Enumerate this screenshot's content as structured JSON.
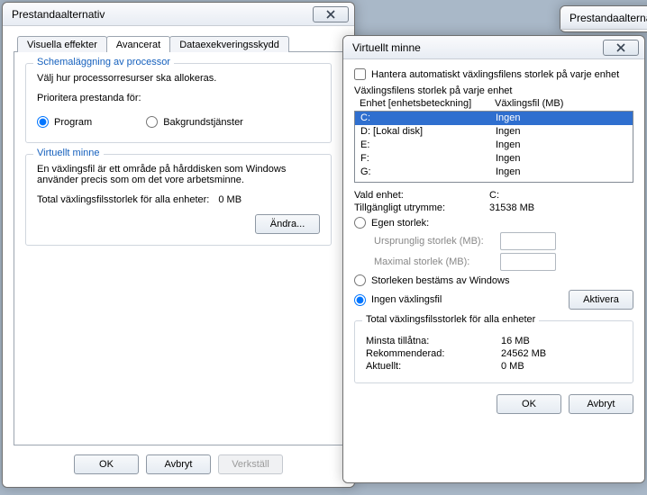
{
  "bgWindow": {
    "title": "Prestandaalternat"
  },
  "perf": {
    "title": "Prestandaalternativ",
    "tabs": {
      "visual": "Visuella effekter",
      "advanced": "Avancerat",
      "dep": "Dataexekveringsskydd"
    },
    "scheduling": {
      "legend": "Schemaläggning av processor",
      "desc": "Välj hur processorresurser ska allokeras.",
      "prioritize": "Prioritera prestanda för:",
      "programs": "Program",
      "background": "Bakgrundstjänster"
    },
    "virtualMemory": {
      "legend": "Virtuellt minne",
      "desc": "En växlingsfil är ett område på hårddisken som Windows använder precis som om det vore arbetsminne.",
      "totalLabel": "Total växlingsfilsstorlek för alla enheter:",
      "totalValue": "0 MB",
      "change": "Ändra..."
    },
    "buttons": {
      "ok": "OK",
      "cancel": "Avbryt",
      "apply": "Verkställ"
    }
  },
  "vm": {
    "title": "Virtuellt minne",
    "autoManage": "Hantera automatiskt växlingsfilens storlek på varje enhet",
    "pageFileSizeHeading": "Växlingsfilens storlek på varje enhet",
    "col1": "Enhet [enhetsbeteckning]",
    "col2": "Växlingsfil (MB)",
    "drives": [
      {
        "letter": "C:",
        "label": "",
        "page": "Ingen",
        "selected": true
      },
      {
        "letter": "D:",
        "label": "[Lokal disk]",
        "page": "Ingen",
        "selected": false
      },
      {
        "letter": "E:",
        "label": "",
        "page": "Ingen",
        "selected": false
      },
      {
        "letter": "F:",
        "label": "",
        "page": "Ingen",
        "selected": false
      },
      {
        "letter": "G:",
        "label": "",
        "page": "Ingen",
        "selected": false
      }
    ],
    "selectedDriveLabel": "Vald enhet:",
    "selectedDriveValue": "C:",
    "availLabel": "Tillgängligt utrymme:",
    "availValue": "31538 MB",
    "customSize": "Egen storlek:",
    "initialSize": "Ursprunglig storlek (MB):",
    "maxSize": "Maximal storlek (MB):",
    "systemManaged": "Storleken bestäms av Windows",
    "noPageFile": "Ingen växlingsfil",
    "activate": "Aktivera",
    "totalHeading": "Total växlingsfilsstorlek för alla enheter",
    "minLabel": "Minsta tillåtna:",
    "minValue": "16 MB",
    "recLabel": "Rekommenderad:",
    "recValue": "24562 MB",
    "curLabel": "Aktuellt:",
    "curValue": "0 MB",
    "ok": "OK",
    "cancel": "Avbryt"
  }
}
